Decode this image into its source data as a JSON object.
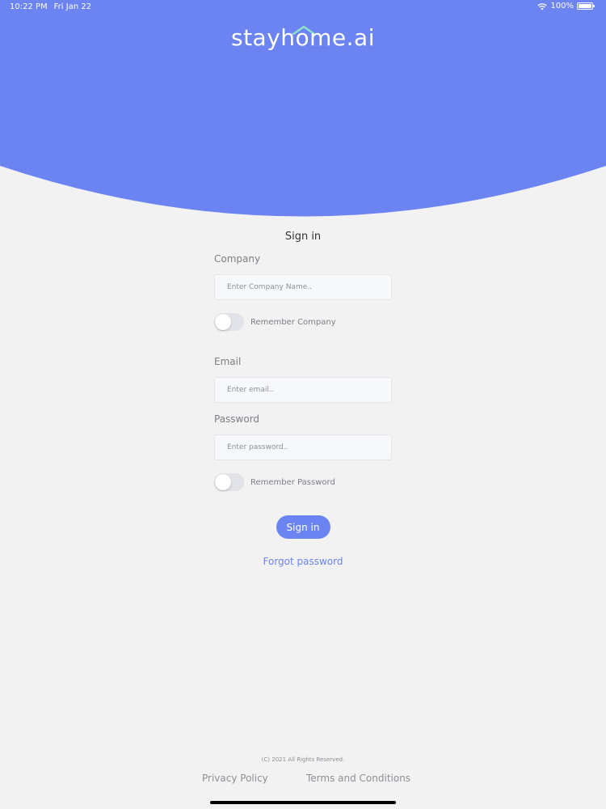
{
  "status_bar": {
    "time": "10:22 PM",
    "date": "Fri Jan 22",
    "battery": "100%"
  },
  "brand": {
    "logo_text": "stayhome.ai",
    "primary_color": "#6b84f2",
    "roof_color": "#8fe0c6"
  },
  "form": {
    "title": "Sign in",
    "company_label": "Company",
    "company_placeholder": "Enter Company Name..",
    "remember_company_label": "Remember Company",
    "email_label": "Email",
    "email_placeholder": "Enter email..",
    "password_label": "Password",
    "password_placeholder": "Enter password..",
    "remember_password_label": "Remember Password",
    "sign_in_button": "Sign in",
    "forgot_password": "Forgot password"
  },
  "footer": {
    "copyright": "(C) 2021 All Rights Reserved.",
    "privacy": "Privacy Policy",
    "terms": "Terms and Conditions"
  }
}
